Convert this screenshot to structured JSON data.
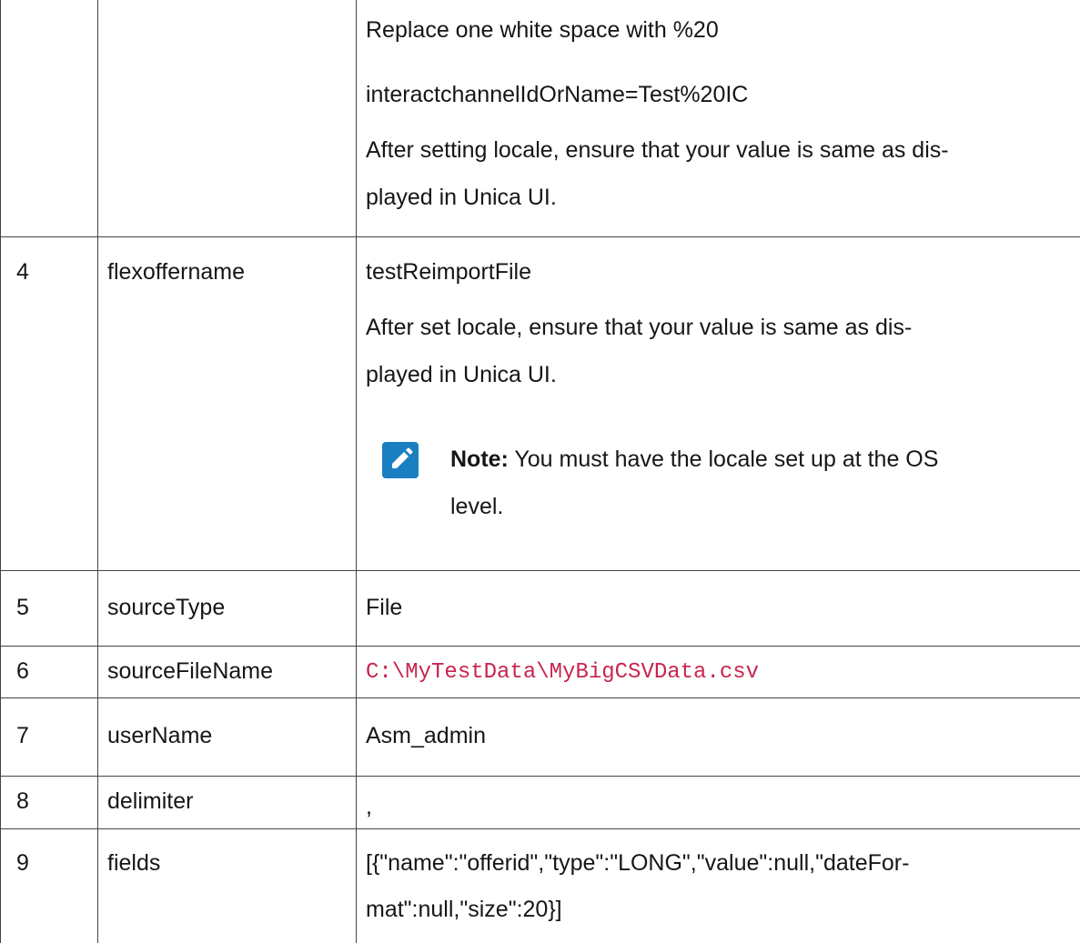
{
  "table": {
    "continued_row": {
      "lines": [
        "Replace one white space with %20",
        "interactchannelIdOrName=Test%20IC",
        "After setting locale, ensure that your value is same as dis-",
        "played in Unica UI."
      ]
    },
    "rows": [
      {
        "num": "4",
        "param": "flexoffername",
        "lines": [
          "testReimportFile",
          "After set locale, ensure that your value is same as dis-",
          "played in Unica UI."
        ],
        "note": {
          "label": "Note:",
          "lines": [
            "You must have the locale set up at the OS",
            "level."
          ]
        }
      },
      {
        "num": "5",
        "param": "sourceType",
        "value": "File"
      },
      {
        "num": "6",
        "param": "sourceFileName",
        "value": "C:\\MyTestData\\MyBigCSVData.csv"
      },
      {
        "num": "7",
        "param": "userName",
        "value": "Asm_admin"
      },
      {
        "num": "8",
        "param": "delimiter",
        "value": ","
      },
      {
        "num": "9",
        "param": "fields",
        "lines": [
          "[{\"name\":\"offerid\",\"type\":\"LONG\",\"value\":null,\"dateFor-",
          "mat\":null,\"size\":20}]"
        ]
      }
    ]
  },
  "icons": {
    "note_icon": "pencil-note-icon",
    "note_icon_color": "#1a7fc1"
  },
  "colors": {
    "code_text": "#c7254e"
  }
}
